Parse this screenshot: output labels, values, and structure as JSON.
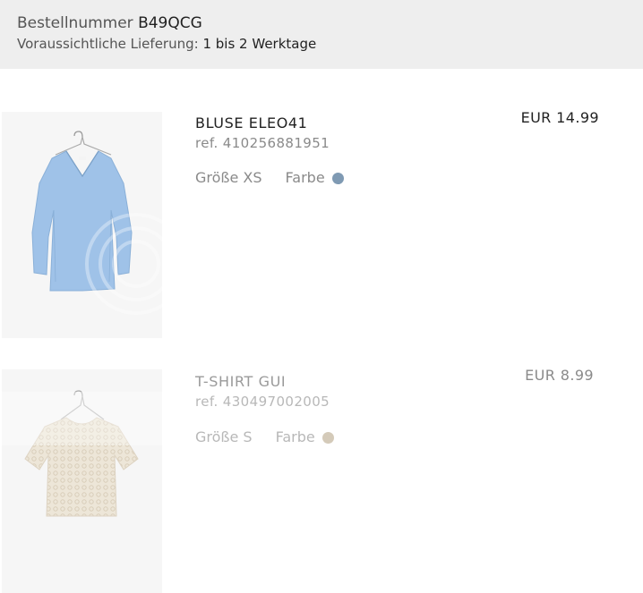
{
  "order": {
    "number_label": "Bestellnummer",
    "number_value": "B49QCG",
    "delivery_label": "Voraussichtliche Lieferung:",
    "delivery_value": "1 bis 2 Werktage"
  },
  "items": [
    {
      "name": "BLUSE ELEO41",
      "ref": "ref. 410256881951",
      "size_label": "Größe XS",
      "color_label": "Farbe",
      "color_hex": "#7f9ab3",
      "price": "EUR 14.99",
      "image_icon": "blue-blouse-product-image"
    },
    {
      "name": "T-SHIRT GUI",
      "ref": "ref. 430497002005",
      "size_label": "Größe S",
      "color_label": "Farbe",
      "color_hex": "#d4cab9",
      "price": "EUR 8.99",
      "image_icon": "lace-tshirt-product-image"
    }
  ]
}
